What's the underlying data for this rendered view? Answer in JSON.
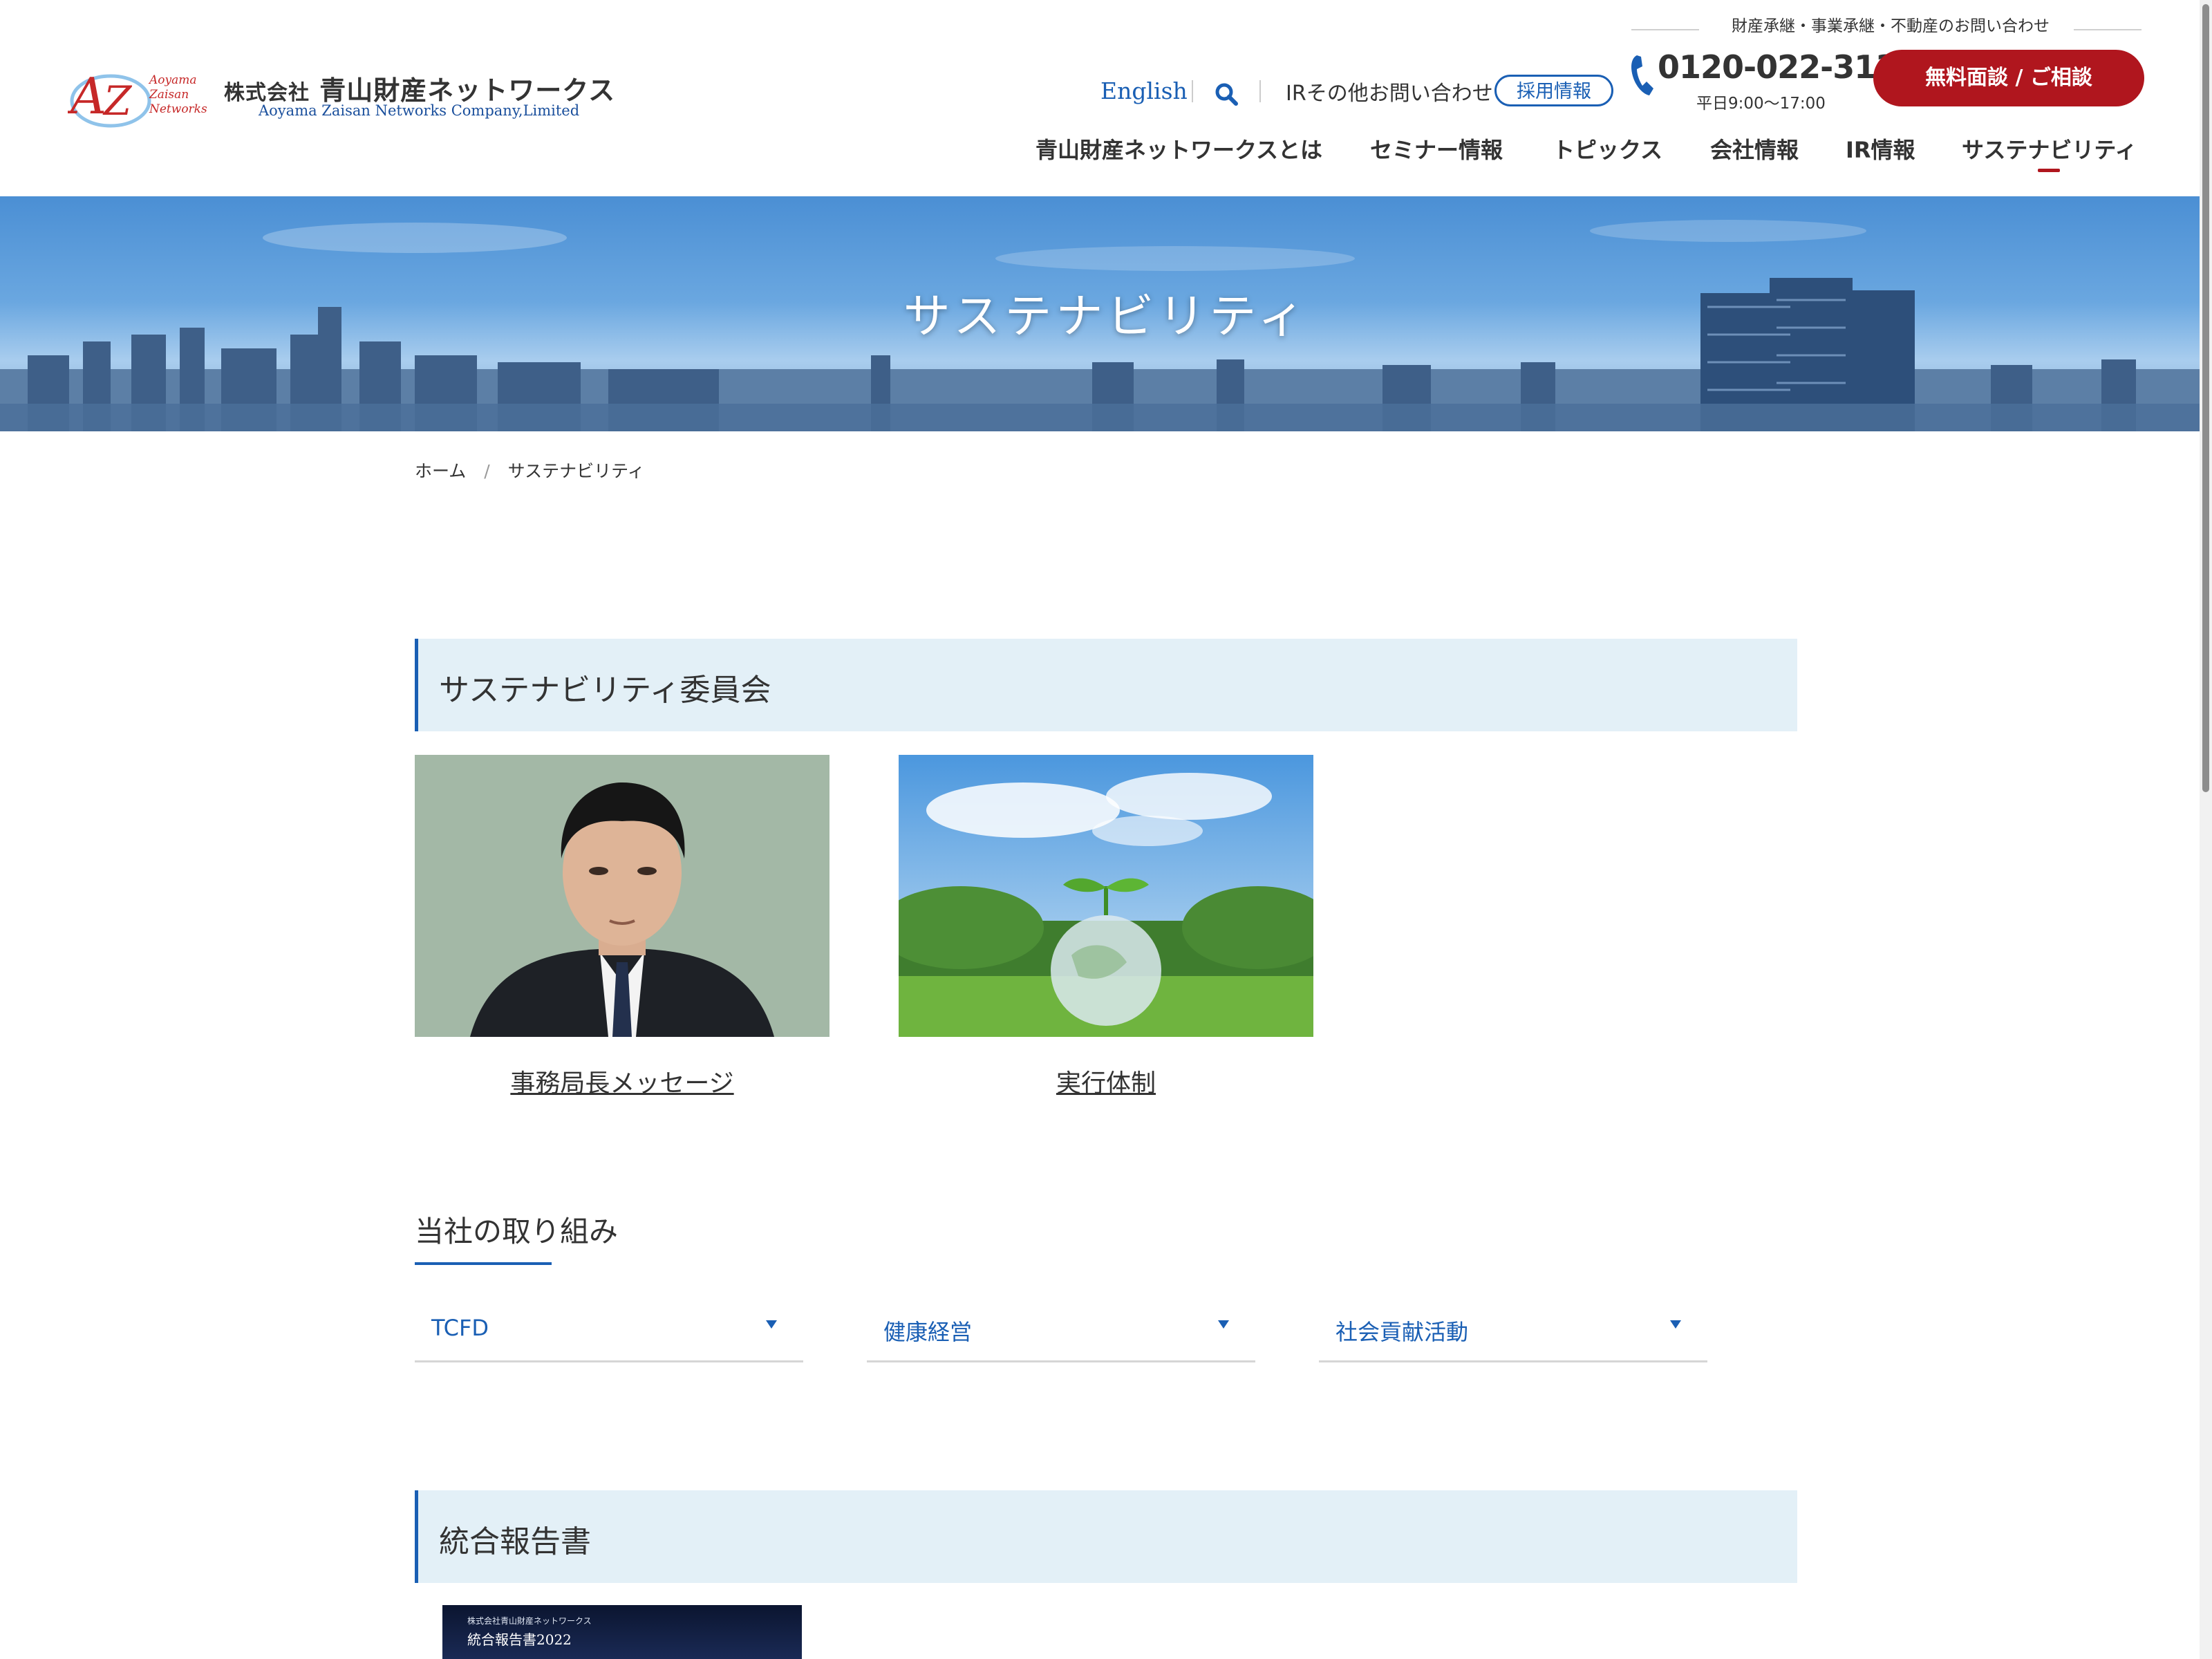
{
  "colors": {
    "brand_red": "#b0161e",
    "brand_blue": "#1a5fb4",
    "section_bg": "#e3f0f7"
  },
  "header": {
    "logo": {
      "mark_letters": "AZ",
      "mark_lines": [
        "Aoyama",
        "Zaisan",
        "Networks"
      ],
      "name_prefix": "株式会社",
      "name_main": "青山財産ネットワークス",
      "name_en": "Aoyama Zaisan Networks Company,Limited"
    },
    "contact_caption": "財産承継・事業承継・不動産のお問い合わせ",
    "english_label": "English",
    "search_icon": "search-icon",
    "ir_contact_label": "IRその他お問い合わせ",
    "recruit_label": "採用情報",
    "phone_icon": "phone-icon",
    "phone_number": "0120-022-313",
    "phone_hours": "平日9:00〜17:00",
    "cta_label": "無料面談 / ご相談",
    "nav": [
      {
        "label": "青山財産ネットワークスとは"
      },
      {
        "label": "セミナー情報"
      },
      {
        "label": "トピックス"
      },
      {
        "label": "会社情報"
      },
      {
        "label": "IR情報"
      },
      {
        "label": "サステナビリティ",
        "active": true
      }
    ]
  },
  "hero": {
    "title": "サステナビリティ"
  },
  "breadcrumb": {
    "home": "ホーム",
    "separator": "/",
    "current": "サステナビリティ"
  },
  "committee": {
    "heading": "サステナビリティ委員会",
    "cards": [
      {
        "label": "事務局長メッセージ",
        "image": "portrait-photo"
      },
      {
        "label": "実行体制",
        "image": "sprout-globe-photo"
      }
    ]
  },
  "initiatives": {
    "heading": "当社の取り組み",
    "dropdowns": [
      {
        "label": "TCFD"
      },
      {
        "label": "健康経営"
      },
      {
        "label": "社会貢献活動"
      }
    ]
  },
  "report": {
    "heading": "統合報告書",
    "cover_small": "株式会社青山財産ネットワークス",
    "cover_title": "統合報告書2022"
  }
}
